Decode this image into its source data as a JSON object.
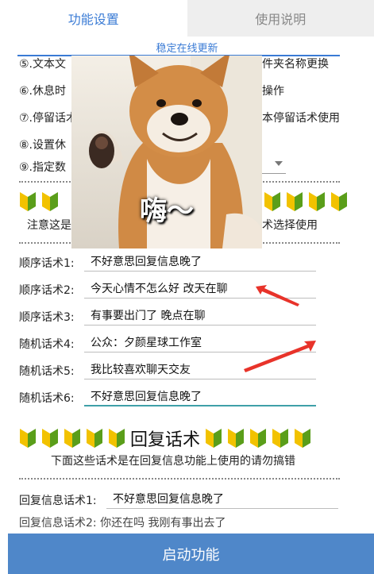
{
  "tabs": {
    "settings": "功能设置",
    "help": "使用说明"
  },
  "update_link": "稳定在线更新",
  "options": {
    "opt5_left": "⑤.文本文",
    "opt5_right": "件夹名称更换",
    "opt6_left": "⑥.休息时",
    "opt6_right": "操作",
    "opt7_left": "⑦.停留话术",
    "opt7_right": "本停留话术使用",
    "opt8_left": "⑧.设置休",
    "opt9_left": "⑨.指定数"
  },
  "notice_top": {
    "left": "注意这是",
    "right": "术选择使用"
  },
  "meme": {
    "caption": "嗨～"
  },
  "script_rows": [
    {
      "label": "顺序话术1:",
      "value": "不好意思回复信息晚了"
    },
    {
      "label": "顺序话术2:",
      "value": "今天心情不怎么好 改天在聊"
    },
    {
      "label": "顺序话术3:",
      "value": "有事要出门了 晚点在聊"
    },
    {
      "label": "随机话术4:",
      "value": "公众：夕颜星球工作室"
    },
    {
      "label": "随机话术5:",
      "value": "我比较喜欢聊天交友"
    },
    {
      "label": "随机话术6:",
      "value": "不好意思回复信息晚了"
    }
  ],
  "reply_section": {
    "title": "回复话术",
    "note": "下面这些话术是在回复信息功能上使用的请勿搞错",
    "row_label": "回复信息话术1:",
    "row_value": "不好意思回复信息晚了",
    "cut_row_text": "回复信息话术2:    你还在吗 我刚有事出去了"
  },
  "launch_button": "启动功能",
  "colors": {
    "accent": "#3a7bd5",
    "button": "#4f87c9",
    "arrow": "#e8332a",
    "badge_yellow": "#f2c200",
    "badge_green": "#5a9e1a"
  },
  "icons": {
    "badge": "beginner-mark-icon"
  }
}
